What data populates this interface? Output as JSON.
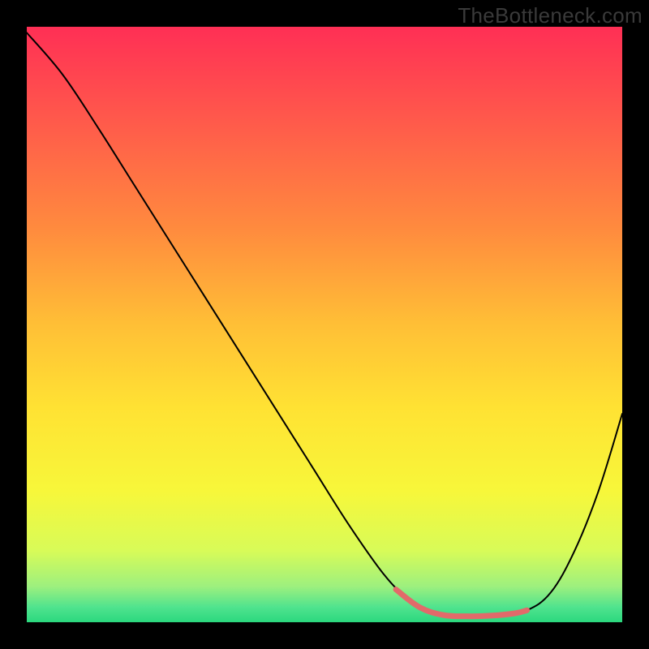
{
  "watermark": "TheBottleneck.com",
  "chart_data": {
    "type": "line",
    "title": "",
    "xlabel": "",
    "ylabel": "",
    "xlim": [
      0,
      100
    ],
    "ylim": [
      0,
      100
    ],
    "grid": false,
    "series": [
      {
        "name": "curve",
        "x": [
          0,
          6,
          12,
          18,
          24,
          30,
          36,
          42,
          48,
          54,
          60,
          64,
          68,
          72,
          76,
          80,
          84,
          88,
          92,
          96,
          100
        ],
        "y": [
          99,
          92,
          83,
          73.5,
          64,
          54.5,
          45,
          35.5,
          26,
          16.5,
          8,
          4,
          1.5,
          1,
          1,
          1.3,
          2,
          5,
          12,
          22,
          35
        ],
        "stroke": "#000000",
        "stroke_width": 2
      },
      {
        "name": "highlight-segment",
        "x": [
          62,
          66,
          70,
          74,
          78,
          82,
          84
        ],
        "y": [
          5.5,
          2.5,
          1.2,
          1,
          1.1,
          1.5,
          2
        ],
        "stroke": "#e26a6a",
        "stroke_width": 7
      }
    ],
    "background": {
      "type": "vertical-gradient",
      "stops": [
        {
          "offset": 0.0,
          "color": "#ff2f55"
        },
        {
          "offset": 0.16,
          "color": "#ff5a4b"
        },
        {
          "offset": 0.34,
          "color": "#ff8b3e"
        },
        {
          "offset": 0.5,
          "color": "#ffbf36"
        },
        {
          "offset": 0.64,
          "color": "#ffe233"
        },
        {
          "offset": 0.78,
          "color": "#f7f73a"
        },
        {
          "offset": 0.88,
          "color": "#d8fb58"
        },
        {
          "offset": 0.94,
          "color": "#9df07e"
        },
        {
          "offset": 0.975,
          "color": "#4fe38e"
        },
        {
          "offset": 1.0,
          "color": "#2bd87e"
        }
      ]
    }
  }
}
